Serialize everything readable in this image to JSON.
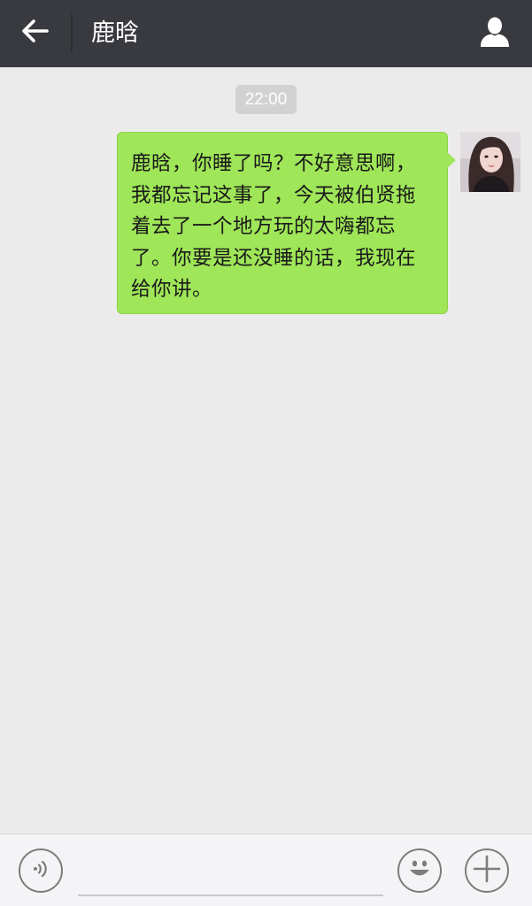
{
  "header": {
    "title": "鹿晗",
    "back_icon": "arrow-left-icon",
    "profile_icon": "person-icon",
    "background": "#393a3f"
  },
  "chat": {
    "background": "#ebebeb",
    "timestamp": "22:00",
    "messages": [
      {
        "direction": "outgoing",
        "text": "鹿晗，你睡了吗？不好意思啊，我都忘记这事了，今天被伯贤拖着去了一个地方玩的太嗨都忘了。你要是还没睡的话，我现在给你讲。",
        "bubble_color": "#9fe658"
      }
    ]
  },
  "input_bar": {
    "voice_icon": "voice-icon",
    "text_value": "",
    "emoji_icon": "emoji-icon",
    "plus_icon": "plus-icon"
  }
}
